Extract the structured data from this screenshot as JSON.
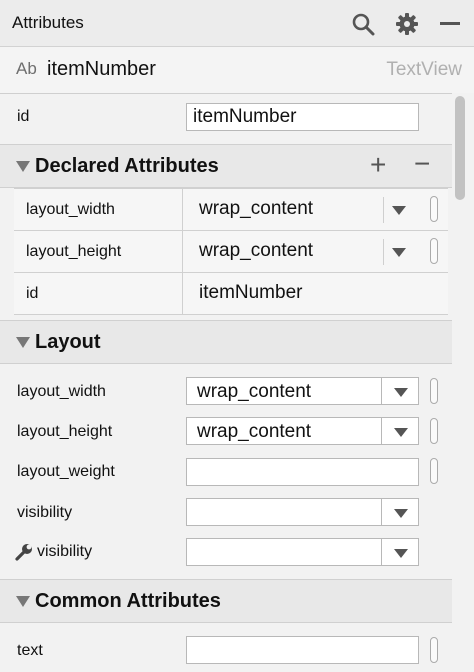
{
  "panel": {
    "title": "Attributes"
  },
  "component": {
    "badge": "Ab",
    "name": "itemNumber",
    "type": "TextView"
  },
  "id_row": {
    "label": "id",
    "value": "itemNumber"
  },
  "declared": {
    "title": "Declared Attributes",
    "add": "+",
    "remove": "−",
    "rows": [
      {
        "name": "layout_width",
        "value": "wrap_content"
      },
      {
        "name": "layout_height",
        "value": "wrap_content"
      },
      {
        "name": "id",
        "value": "itemNumber"
      }
    ]
  },
  "layout": {
    "title": "Layout",
    "rows": [
      {
        "label": "layout_width",
        "value": "wrap_content"
      },
      {
        "label": "layout_height",
        "value": "wrap_content"
      },
      {
        "label": "layout_weight",
        "value": ""
      },
      {
        "label": "visibility",
        "value": ""
      },
      {
        "label": "visibility",
        "value": ""
      }
    ]
  },
  "common": {
    "title": "Common Attributes",
    "rows": [
      {
        "label": "text",
        "value": ""
      }
    ]
  }
}
